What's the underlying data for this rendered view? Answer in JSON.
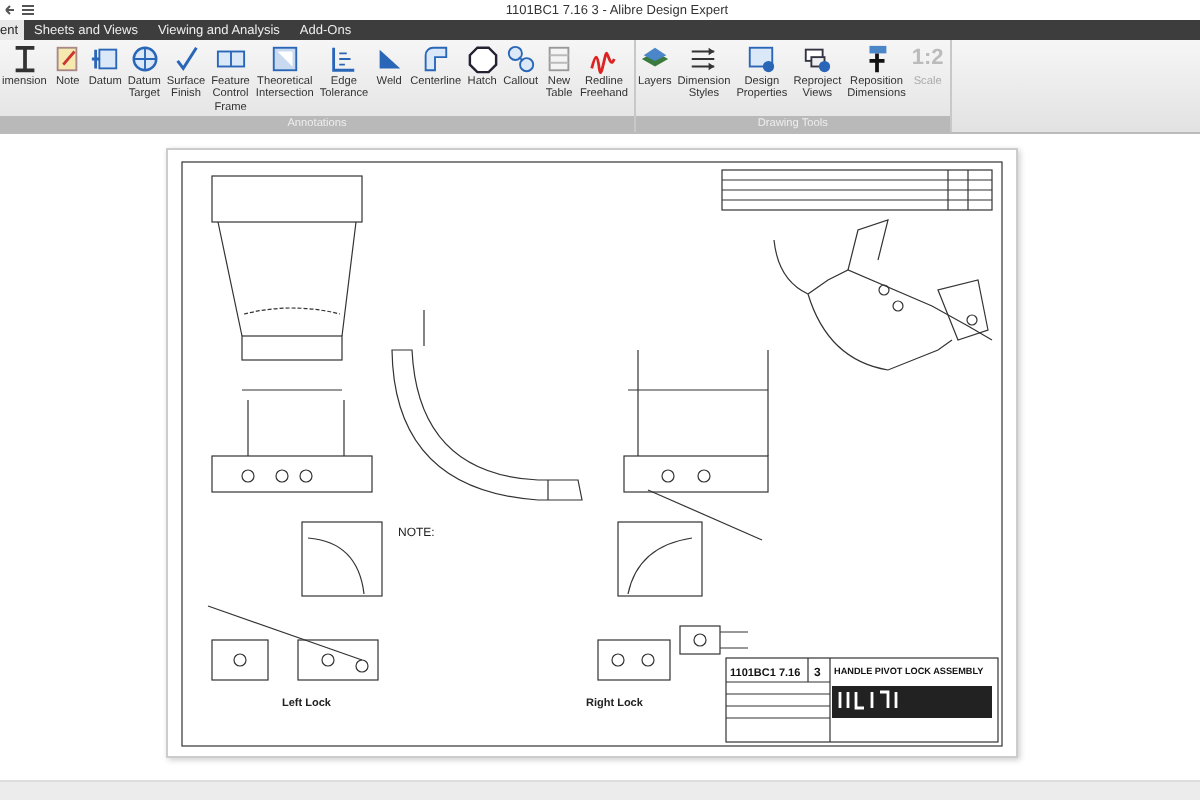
{
  "window": {
    "title": "1101BC1 7.16 3 - Alibre Design Expert"
  },
  "tabs": [
    {
      "label": "ent",
      "selected": true
    },
    {
      "label": "Sheets and Views",
      "selected": false
    },
    {
      "label": "Viewing and Analysis",
      "selected": false
    },
    {
      "label": "Add-Ons",
      "selected": false
    }
  ],
  "ribbon": {
    "groups": [
      {
        "label": "Annotations",
        "buttons": [
          {
            "label": "imension",
            "disabled": false
          },
          {
            "label": "Note",
            "disabled": false
          },
          {
            "label": "Datum",
            "disabled": false
          },
          {
            "label": "Datum Target",
            "disabled": false
          },
          {
            "label": "Surface Finish",
            "disabled": false
          },
          {
            "label": "Feature Control Frame",
            "disabled": false
          },
          {
            "label": "Theoretical Intersection",
            "disabled": false
          },
          {
            "label": "Edge Tolerance",
            "disabled": false
          },
          {
            "label": "Weld",
            "disabled": false
          },
          {
            "label": "Centerline",
            "disabled": false
          },
          {
            "label": "Hatch",
            "disabled": false
          },
          {
            "label": "Callout",
            "disabled": false
          },
          {
            "label": "New Table",
            "disabled": false
          },
          {
            "label": "Redline Freehand",
            "disabled": false
          }
        ]
      },
      {
        "label": "Drawing Tools",
        "buttons": [
          {
            "label": "Layers",
            "disabled": false
          },
          {
            "label": "Dimension Styles",
            "disabled": false
          },
          {
            "label": "Design Properties",
            "disabled": false
          },
          {
            "label": "Reproject Views",
            "disabled": false
          },
          {
            "label": "Reposition Dimensions",
            "disabled": false
          },
          {
            "label": "Scale",
            "icon_text": "1:2",
            "disabled": true
          }
        ]
      }
    ]
  },
  "drawing": {
    "note": "NOTE:",
    "views": [
      {
        "label": "Left Lock"
      },
      {
        "label": "Right Lock"
      }
    ],
    "title_block": {
      "number": "1101BC1 7.16",
      "sheet": "3",
      "title": "HANDLE PIVOT LOCK ASSEMBLY"
    }
  }
}
